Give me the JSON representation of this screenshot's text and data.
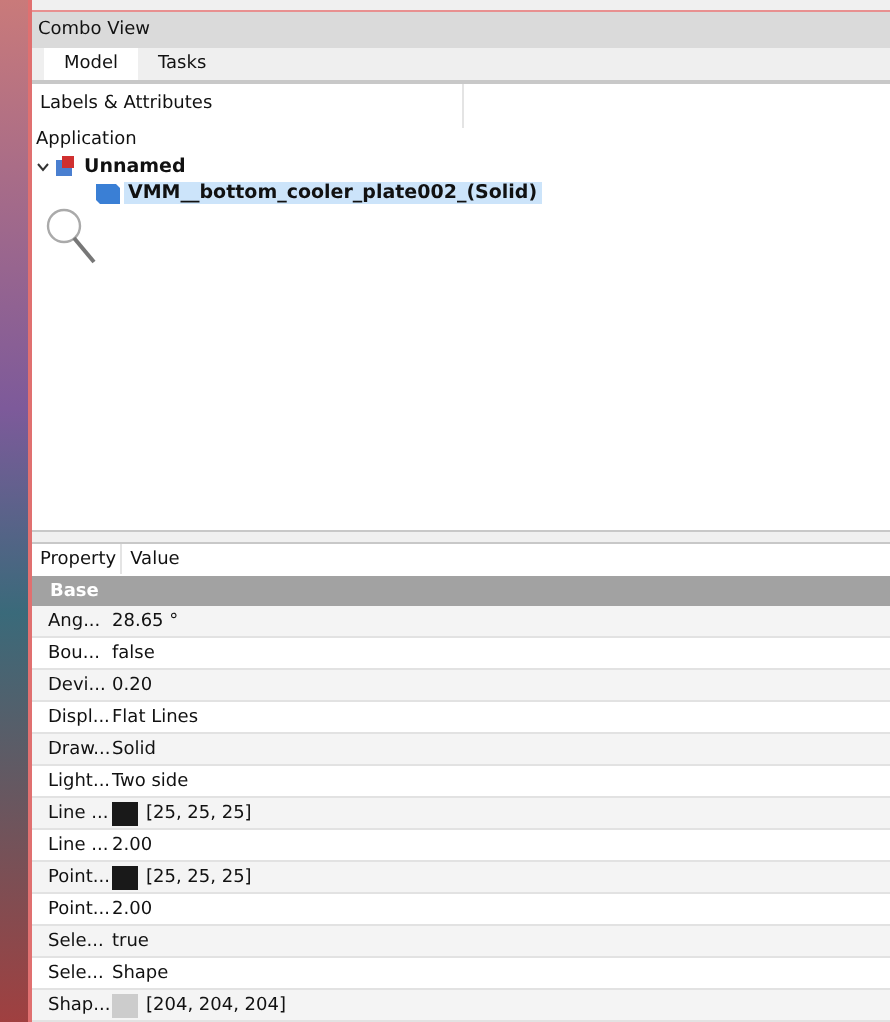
{
  "panel": {
    "title": "Combo View"
  },
  "tabs": [
    {
      "label": "Model",
      "selected": true
    },
    {
      "label": "Tasks",
      "selected": false
    }
  ],
  "tree": {
    "header": "Labels & Attributes",
    "root_label": "Application",
    "items": [
      {
        "label": "Unnamed",
        "expanded": true,
        "selected": false,
        "children": [
          {
            "label": "VMM__bottom_cooler_plate002_(Solid)",
            "selected": true
          }
        ]
      }
    ]
  },
  "properties": {
    "columns": [
      "Property",
      "Value"
    ],
    "group": "Base",
    "rows": [
      {
        "kind": "text",
        "name": "Ang...",
        "value": "28.65 °"
      },
      {
        "kind": "text",
        "name": "Bou...",
        "value": "false"
      },
      {
        "kind": "text",
        "name": "Devi...",
        "value": "0.20"
      },
      {
        "kind": "text",
        "name": "Displ...",
        "value": "Flat Lines"
      },
      {
        "kind": "text",
        "name": "Draw...",
        "value": "Solid"
      },
      {
        "kind": "text",
        "name": "Light...",
        "value": "Two side"
      },
      {
        "kind": "color",
        "name": "Line ...",
        "value": "[25, 25, 25]",
        "color": "#191919"
      },
      {
        "kind": "text",
        "name": "Line ...",
        "value": "2.00"
      },
      {
        "kind": "color",
        "name": "Point...",
        "value": "[25, 25, 25]",
        "color": "#191919"
      },
      {
        "kind": "text",
        "name": "Point...",
        "value": "2.00"
      },
      {
        "kind": "text",
        "name": "Sele...",
        "value": "true"
      },
      {
        "kind": "text",
        "name": "Sele...",
        "value": "Shape"
      },
      {
        "kind": "color",
        "name": "Shap...",
        "value": "[204, 204, 204]",
        "color": "#cccccc"
      }
    ]
  }
}
